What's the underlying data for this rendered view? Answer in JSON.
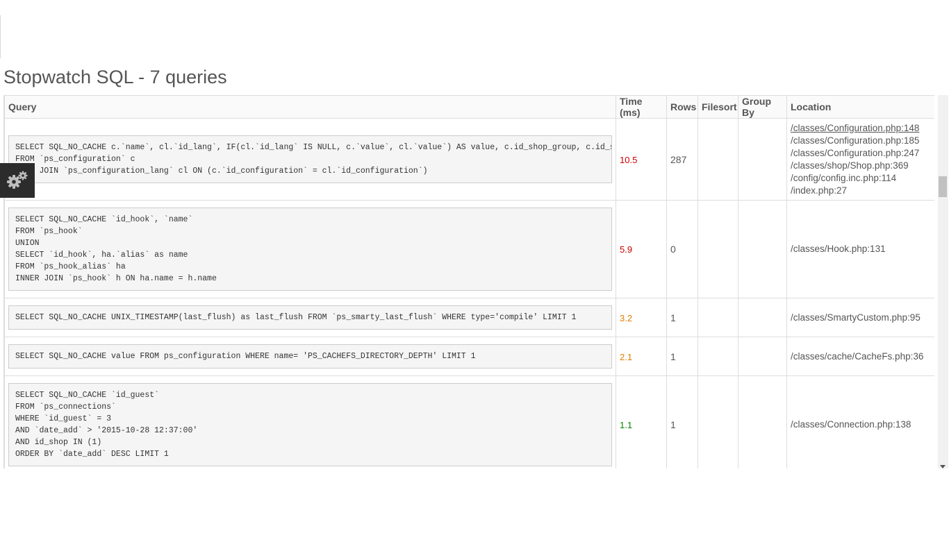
{
  "page": {
    "title": "Stopwatch SQL - 7 queries"
  },
  "table": {
    "headers": {
      "query": "Query",
      "time": "Time (ms)",
      "rows": "Rows",
      "filesort": "Filesort",
      "group_by": "Group By",
      "location": "Location"
    },
    "rows": [
      {
        "query": "SELECT SQL_NO_CACHE c.`name`, cl.`id_lang`, IF(cl.`id_lang` IS NULL, c.`value`, cl.`value`) AS value, c.id_shop_group, c.id_shop\nFROM `ps_configuration` c\nLEFT JOIN `ps_configuration_lang` cl ON (c.`id_configuration` = cl.`id_configuration`)",
        "time": "10.5",
        "rows": "287",
        "filesort": "",
        "group_by": "",
        "locations": [
          "/classes/Configuration.php:148",
          "/classes/Configuration.php:185",
          "/classes/Configuration.php:247",
          "/classes/shop/Shop.php:369",
          "/config/config.inc.php:114",
          "/index.php:27"
        ]
      },
      {
        "query": "SELECT SQL_NO_CACHE `id_hook`, `name`\nFROM `ps_hook`\nUNION\nSELECT `id_hook`, ha.`alias` as name\nFROM `ps_hook_alias` ha\nINNER JOIN `ps_hook` h ON ha.name = h.name",
        "time": "5.9",
        "rows": "0",
        "filesort": "",
        "group_by": "",
        "locations": [
          "/classes/Hook.php:131"
        ]
      },
      {
        "query": "SELECT SQL_NO_CACHE UNIX_TIMESTAMP(last_flush) as last_flush FROM `ps_smarty_last_flush` WHERE type='compile' LIMIT 1",
        "time": "3.2",
        "rows": "1",
        "filesort": "",
        "group_by": "",
        "locations": [
          "/classes/SmartyCustom.php:95"
        ]
      },
      {
        "query": "SELECT SQL_NO_CACHE value FROM ps_configuration WHERE name= 'PS_CACHEFS_DIRECTORY_DEPTH' LIMIT 1",
        "time": "2.1",
        "rows": "1",
        "filesort": "",
        "group_by": "",
        "locations": [
          "/classes/cache/CacheFs.php:36"
        ]
      },
      {
        "query": "SELECT SQL_NO_CACHE `id_guest`\nFROM `ps_connections`\nWHERE `id_guest` = 3\nAND `date_add` > '2015-10-28 12:37:00'\nAND id_shop IN (1)\nORDER BY `date_add` DESC LIMIT 1",
        "time": "1.1",
        "rows": "1",
        "filesort": "",
        "group_by": "",
        "locations": [
          "/classes/Connection.php:138"
        ]
      }
    ]
  },
  "colors": {
    "time_high": "#cc0000",
    "time_mid": "#e08000",
    "time_low": "#008800"
  },
  "icons": {
    "toolbar": "gears-icon"
  }
}
